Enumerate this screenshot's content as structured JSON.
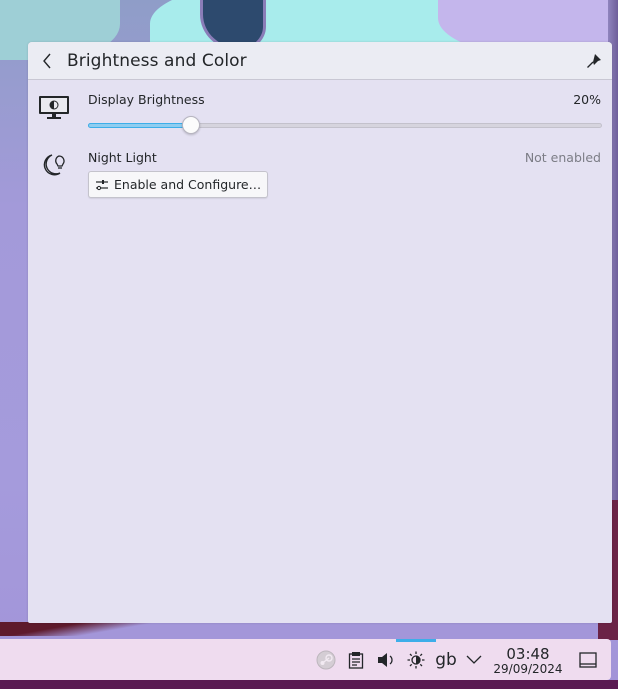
{
  "popup": {
    "title": "Brightness and Color",
    "back_icon": "chevron-left-icon",
    "pin_icon": "pin-icon"
  },
  "display_brightness": {
    "label": "Display Brightness",
    "value_text": "20%",
    "value_fraction": 0.2,
    "icon": "monitor-brightness-icon"
  },
  "night_light": {
    "label": "Night Light",
    "status": "Not enabled",
    "icon": "night-light-icon",
    "button_label": "Enable and Configure…",
    "button_icon": "configure-sliders-icon"
  },
  "taskbar": {
    "tray": [
      {
        "name": "steam-icon"
      },
      {
        "name": "clipboard-icon"
      },
      {
        "name": "volume-icon"
      },
      {
        "name": "brightness-icon"
      }
    ],
    "keyboard_layout": "gb",
    "expand_icon": "chevron-down-icon",
    "clock": {
      "time": "03:48",
      "date": "29/09/2024"
    },
    "show_desktop_icon": "show-desktop-icon",
    "accent_color": "#3daee9"
  }
}
